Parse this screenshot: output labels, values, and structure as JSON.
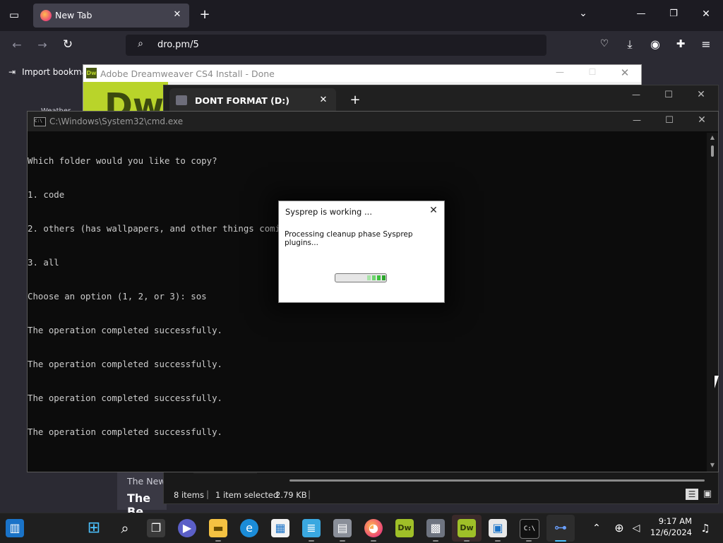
{
  "browser": {
    "tab_title": "New Tab",
    "url": "dro.pm/5",
    "bookmark_item": "Import bookma",
    "page_snippet_1": "The New",
    "page_snippet_2": "The Be",
    "page_snippet_3": "Weather"
  },
  "dreamweaver": {
    "title": "Adobe Dreamweaver CS4 Install - Done",
    "logo_text": "Dw"
  },
  "explorer": {
    "tab_title": "DONT FORMAT (D:)",
    "status_items": "8 items",
    "status_selected": "1 item selected",
    "status_size": "2.79 KB"
  },
  "cmd": {
    "title": "C:\\Windows\\System32\\cmd.exe",
    "lines": [
      "Which folder would you like to copy?",
      "1. code",
      "2. others (has wallpapers, and other things coming soon)",
      "3. all",
      "Choose an option (1, 2, or 3): sos",
      "The operation completed successfully.",
      "The operation completed successfully.",
      "The operation completed successfully.",
      "The operation completed successfully."
    ]
  },
  "sysprep": {
    "title": "Sysprep is working ...",
    "message": "Processing cleanup phase Sysprep plugins..."
  },
  "taskbar": {
    "time": "9:17 AM",
    "date": "12/6/2024"
  },
  "colors": {
    "accent": "#b9d42a",
    "taskbar_bg": "#1f1f1f",
    "cmd_bg": "#0c0c0c",
    "progress": "#3cc23c"
  }
}
